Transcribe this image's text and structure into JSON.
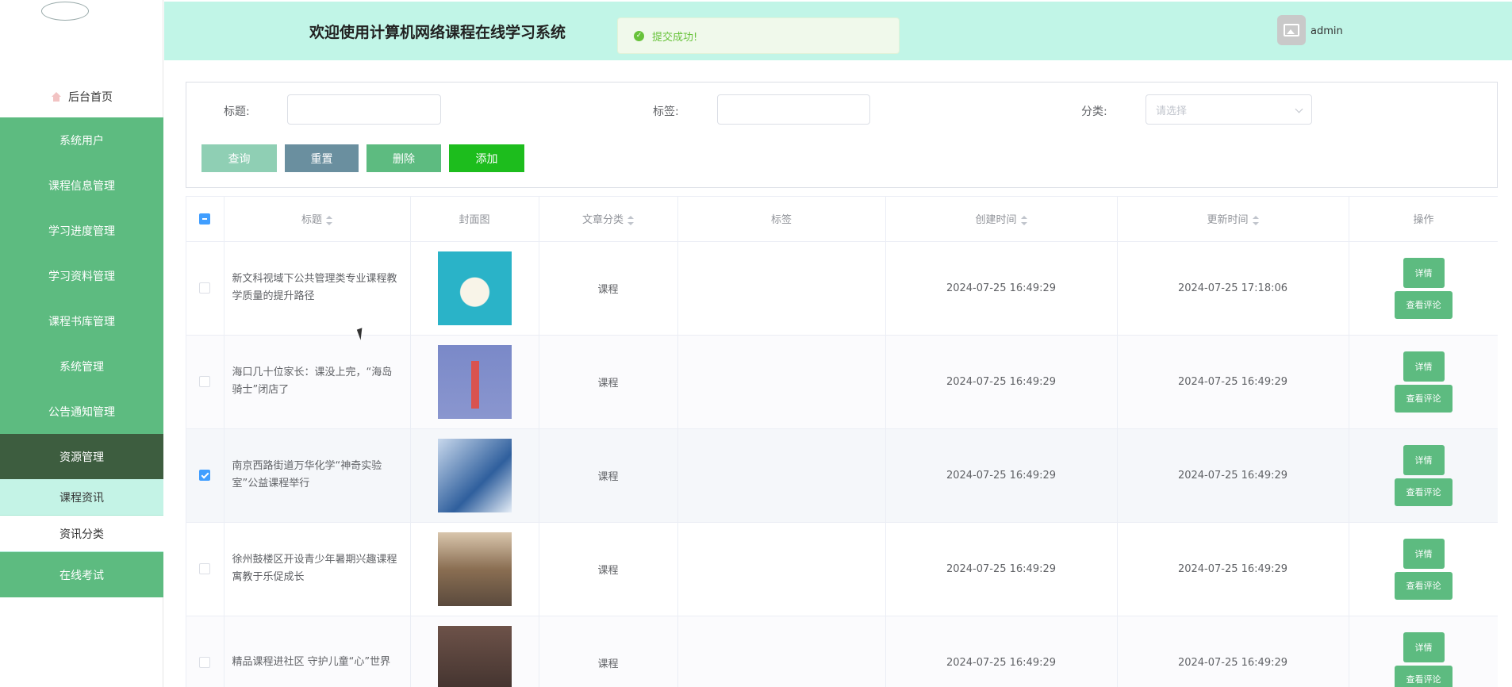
{
  "app": {
    "title": "欢迎使用计算机网络课程在线学习系统",
    "user": "admin",
    "toast": "提交成功!"
  },
  "sidebar": {
    "home": "后台首页",
    "items": [
      {
        "label": "系统用户"
      },
      {
        "label": "课程信息管理"
      },
      {
        "label": "学习进度管理"
      },
      {
        "label": "学习资料管理"
      },
      {
        "label": "课程书库管理"
      },
      {
        "label": "系统管理"
      },
      {
        "label": "公告通知管理"
      },
      {
        "label": "资源管理"
      }
    ],
    "sub_items": [
      {
        "label": "课程资讯"
      },
      {
        "label": "资讯分类"
      }
    ],
    "last": "在线考试"
  },
  "search": {
    "title_label": "标题:",
    "tag_label": "标签:",
    "category_label": "分类:",
    "category_placeholder": "请选择",
    "title_value": "",
    "tag_value": "",
    "buttons": {
      "query": "查询",
      "reset": "重置",
      "delete": "删除",
      "add": "添加"
    }
  },
  "table": {
    "headers": {
      "title": "标题",
      "cover": "封面图",
      "category": "文章分类",
      "tags": "标签",
      "created": "创建时间",
      "updated": "更新时间",
      "ops": "操作"
    },
    "rows": [
      {
        "title": "新文科视域下公共管理类专业课程教学质量的提升路径",
        "category": "课程",
        "tags": "",
        "created": "2024-07-25 16:49:29",
        "updated": "2024-07-25 17:18:06",
        "checked": false
      },
      {
        "title": "海口几十位家长：课没上完，“海岛骑士”闭店了",
        "category": "课程",
        "tags": "",
        "created": "2024-07-25 16:49:29",
        "updated": "2024-07-25 16:49:29",
        "checked": false
      },
      {
        "title": "南京西路街道万华化学“神奇实验室”公益课程举行",
        "category": "课程",
        "tags": "",
        "created": "2024-07-25 16:49:29",
        "updated": "2024-07-25 16:49:29",
        "checked": true
      },
      {
        "title": "徐州鼓楼区开设青少年暑期兴趣课程 寓教于乐促成长",
        "category": "课程",
        "tags": "",
        "created": "2024-07-25 16:49:29",
        "updated": "2024-07-25 16:49:29",
        "checked": false
      },
      {
        "title": "精品课程进社区 守护儿童“心”世界",
        "category": "课程",
        "tags": "",
        "created": "2024-07-25 16:49:29",
        "updated": "2024-07-25 16:49:29",
        "checked": false
      }
    ],
    "op_labels": {
      "detail": "详情",
      "comment": "查看评论"
    }
  },
  "colors": {
    "sidebar_green": "#5dbb80",
    "sidebar_active": "#3d5d3f",
    "header_bg": "#c1f5e7",
    "btn_query": "#8fcfb4",
    "btn_reset": "#6a8f9f",
    "btn_delete": "#5dbb80",
    "btn_add": "#1dbd1d"
  }
}
